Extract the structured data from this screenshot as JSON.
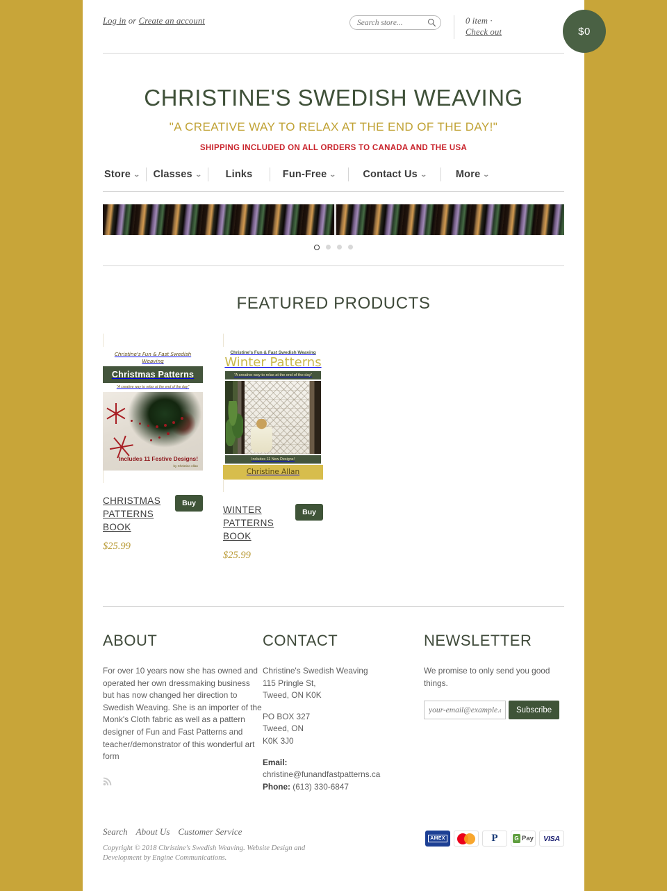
{
  "brand": {
    "accent_green": "#3f5438",
    "accent_gold": "#c8a539",
    "title": "CHRISTINE'S SWEDISH WEAVING",
    "tagline": "\"A CREATIVE WAY TO RELAX AT THE END OF THE DAY!\"",
    "shipping_notice": "SHIPPING INCLUDED ON ALL ORDERS TO CANADA AND THE USA"
  },
  "utility": {
    "login_label": "Log in",
    "or_label": " or ",
    "create_account_label": "Create an account",
    "search_placeholder": "Search store...",
    "search_value": "",
    "cart_items": "0 item",
    "cart_dot": " · ",
    "checkout_label": "Check out",
    "cart_total": "$0"
  },
  "nav": {
    "items": [
      {
        "label": "Store",
        "has_caret": true
      },
      {
        "label": "Classes",
        "has_caret": true
      },
      {
        "label": "Links",
        "has_caret": false
      },
      {
        "label": "Fun-Free",
        "has_caret": true
      },
      {
        "label": "Contact Us",
        "has_caret": true
      },
      {
        "label": "More",
        "has_caret": true
      }
    ]
  },
  "slider": {
    "alt": "colorful yarn skeins banner",
    "dot_count": 4,
    "active_dot": 1
  },
  "featured": {
    "heading": "FEATURED PRODUCTS",
    "products": [
      {
        "name": "CHRISTMAS PATTERNS BOOK",
        "price": "$25.99",
        "buy_label": "Buy",
        "cover": {
          "kicker": "Christine's Fun & Fast Swedish Weaving",
          "title": "Christmas Patterns",
          "quote": "\"A creative way to relax at the end of the day\"",
          "badge": "Includes 11 Festive Designs!",
          "author": "by Christine Allan"
        }
      },
      {
        "name": "WINTER PATTERNS BOOK",
        "price": "$25.99",
        "buy_label": "Buy",
        "cover": {
          "kicker": "Christine's Fun & Fast Swedish Weaving",
          "title": "Winter Patterns",
          "quote": "\"A creative way to relax at the end of the day\"",
          "badge": "Includes 11 New Designs!",
          "author": "Christine Allan"
        }
      }
    ]
  },
  "footer": {
    "about": {
      "heading": "ABOUT",
      "body": "For over 10 years now she has owned and operated her own dressmaking business but has now changed her direction to Swedish Weaving. She is an importer of the Monk's Cloth fabric as well as a pattern designer of Fun and Fast Patterns and teacher/demonstrator of this wonderful art form"
    },
    "contact": {
      "heading": "CONTACT",
      "company": "Christine's Swedish Weaving",
      "street": "115 Pringle St,",
      "city_line": "Tweed, ON K0K",
      "po_box": "PO BOX 327",
      "po_city": "Tweed, ON",
      "po_postal": "K0K 3J0",
      "email_label": "Email:",
      "email": "christine@funandfastpatterns.ca",
      "phone_label": "Phone:",
      "phone": "(613) 330-6847"
    },
    "newsletter": {
      "heading": "NEWSLETTER",
      "promise": "We promise to only send you good things.",
      "email_placeholder": "your-email@example.com",
      "email_value": "",
      "subscribe_label": "Subscribe"
    }
  },
  "subfooter": {
    "links": [
      "Search",
      "About Us",
      "Customer Service"
    ],
    "copyright": "Copyright © 2018 Christine's Swedish Weaving. Website Design and Development by Engine Communications.",
    "payments": [
      {
        "name": "amex",
        "label": "AMEX"
      },
      {
        "name": "mastercard",
        "label": ""
      },
      {
        "name": "paypal",
        "label": "P"
      },
      {
        "name": "google-pay",
        "label": "Pay"
      },
      {
        "name": "visa",
        "label": "VISA"
      }
    ]
  }
}
